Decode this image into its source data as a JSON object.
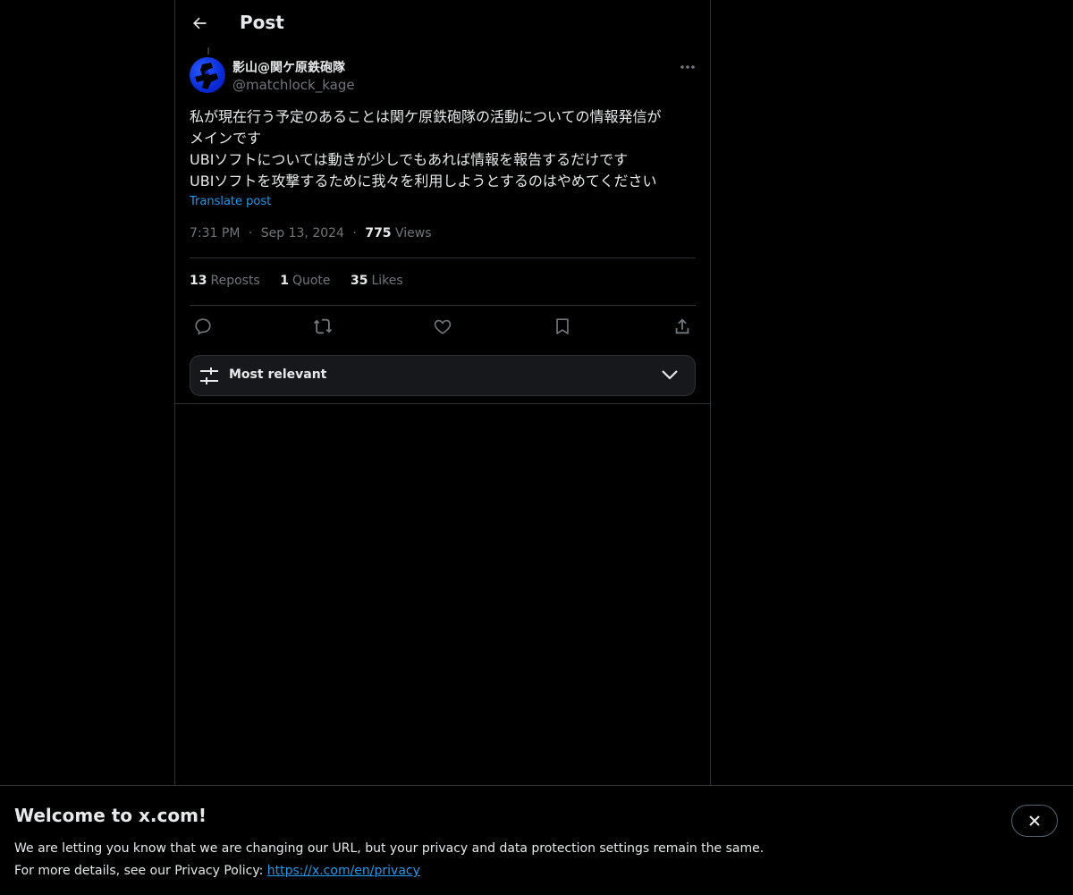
{
  "header": {
    "title": "Post"
  },
  "post": {
    "display_name": "影山@関ケ原鉄砲隊",
    "handle": "@matchlock_kage",
    "text": "私が現在行う予定のあることは関ケ原鉄砲隊の活動についての情報発信が\nメインです\nUBIソフトについては動きが少しでもあれば情報を報告するだけです\nUBIソフトを攻撃するために我々を利用しようとするのはやめてください",
    "translate_label": "Translate post",
    "time": "7:31 PM",
    "separator": "·",
    "date": "Sep 13, 2024",
    "views_count": "775",
    "views_label": "Views",
    "reposts_count": "13",
    "reposts_label": "Reposts",
    "quotes_count": "1",
    "quotes_label": "Quote",
    "likes_count": "35",
    "likes_label": "Likes"
  },
  "replies_sort": {
    "label": "Most relevant"
  },
  "banner": {
    "title": "Welcome to x.com!",
    "line1": "We are letting you know that we are changing our URL, but your privacy and data protection settings remain the same.",
    "line2_prefix": "For more details, see our Privacy Policy: ",
    "link": "https://x.com/en/privacy"
  },
  "colors": {
    "background": "#000000",
    "text": "#e7e9ea",
    "muted": "#71767b",
    "accent": "#1d9bf0",
    "border": "#2f3336"
  }
}
